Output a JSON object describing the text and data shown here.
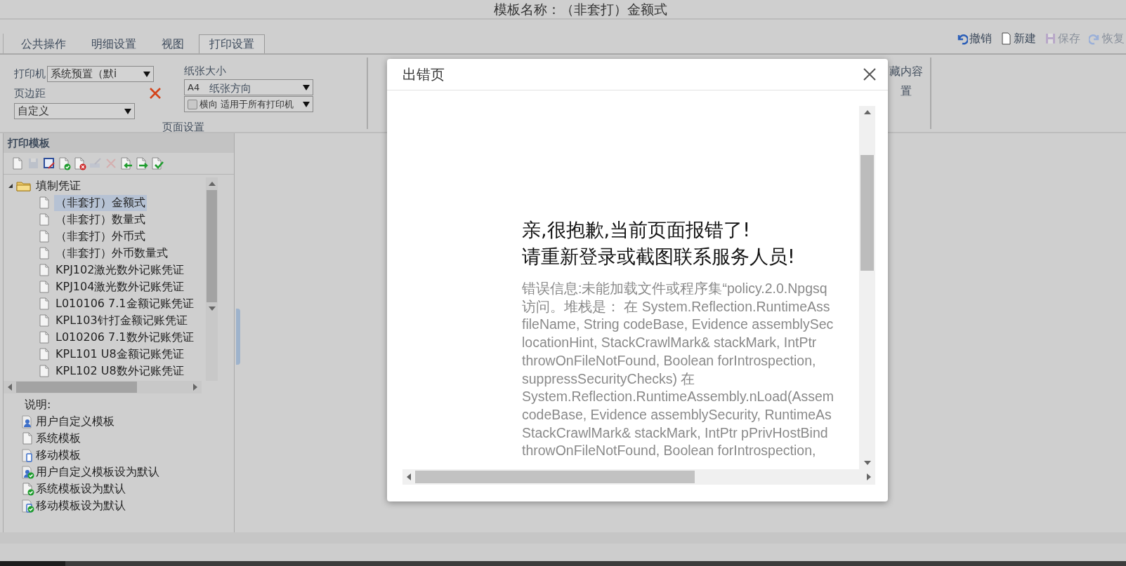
{
  "window": {
    "title": "模板名称：（非套打）金额式"
  },
  "tabs": [
    {
      "label": "公共操作",
      "selected": false
    },
    {
      "label": "明细设置",
      "selected": false
    },
    {
      "label": "视图",
      "selected": false
    },
    {
      "label": "打印设置",
      "selected": true
    }
  ],
  "actions": [
    {
      "kind": "undo",
      "label": "撤销",
      "disabled": false
    },
    {
      "kind": "new",
      "label": "新建",
      "disabled": false
    },
    {
      "kind": "save",
      "label": "保存",
      "disabled": true
    },
    {
      "kind": "redo",
      "label": "恢复",
      "disabled": true
    }
  ],
  "page_setup": {
    "printer_label": "打印机",
    "printer_value": "系统预置（默i",
    "margin_label": "页边距",
    "margin_value": "自定义",
    "paper_size_label": "纸张大小",
    "paper_size_value": "A4",
    "orientation_label": "纸张方向",
    "landscape_label": "横向",
    "landscape_checked": false,
    "apply_value": "适用于所有打印机",
    "section_label": "页面设置"
  },
  "hidden_section": {
    "line_1": "藏内容",
    "line_2": "置"
  },
  "template_panel": {
    "title": "打印模板",
    "tools": [
      {
        "kind": "new",
        "disabled": false
      },
      {
        "kind": "save",
        "disabled": true
      },
      {
        "kind": "edit",
        "disabled": false
      },
      {
        "kind": "default",
        "disabled": false
      },
      {
        "kind": "delete",
        "disabled": false
      },
      {
        "kind": "rename",
        "disabled": true
      },
      {
        "kind": "remove",
        "disabled": true
      },
      {
        "kind": "import",
        "disabled": false
      },
      {
        "kind": "export",
        "disabled": false
      },
      {
        "kind": "apply",
        "disabled": false
      }
    ],
    "tree": [
      {
        "label": "填制凭证",
        "expanded": true,
        "children": [
          {
            "label": "（非套打）金额式",
            "selected": true
          },
          {
            "label": "（非套打）数量式",
            "selected": false
          },
          {
            "label": "（非套打）外币式",
            "selected": false
          },
          {
            "label": "（非套打）外币数量式",
            "selected": false
          },
          {
            "label": "KPJ102激光数外记账凭证",
            "selected": false
          },
          {
            "label": "KPJ104激光数外记账凭证",
            "selected": false
          },
          {
            "label": "L010106 7.1金额记账凭证",
            "selected": false
          },
          {
            "label": "KPL103针打金额记账凭证",
            "selected": false
          },
          {
            "label": "L010206 7.1数外记账凭证",
            "selected": false
          },
          {
            "label": "KPL101 U8金额记账凭证",
            "selected": false
          },
          {
            "label": "KPL102 U8数外记账凭证",
            "selected": false
          }
        ]
      }
    ],
    "legend_title": "说明:",
    "legend": [
      {
        "kind": "user",
        "label": "用户自定义模板"
      },
      {
        "kind": "system",
        "label": "系统模板"
      },
      {
        "kind": "mobile",
        "label": "移动模板"
      },
      {
        "kind": "user-default",
        "label": "用户自定义模板设为默认"
      },
      {
        "kind": "system-default",
        "label": "系统模板设为默认"
      },
      {
        "kind": "mobile-default",
        "label": "移动模板设为默认"
      }
    ]
  },
  "dialog": {
    "title": "出错页",
    "headline": [
      "亲,很抱歉,当前页面报错了!",
      "请重新登录或截图联系服务人员!"
    ],
    "details": [
      "错误信息:未能加载文件或程序集“policy.2.0.Npgsq",
      "访问。堆栈是：  在 System.Reflection.RuntimeAss",
      "fileName, String codeBase, Evidence assemblySec",
      "locationHint, StackCrawlMark& stackMark, IntPtr",
      "throwOnFileNotFound, Boolean forIntrospection,",
      "suppressSecurityChecks) 在",
      "System.Reflection.RuntimeAssembly.nLoad(Assem",
      "codeBase, Evidence assemblySecurity, RuntimeAs",
      "StackCrawlMark& stackMark, IntPtr pPrivHostBind",
      "throwOnFileNotFound, Boolean forIntrospection,"
    ]
  }
}
